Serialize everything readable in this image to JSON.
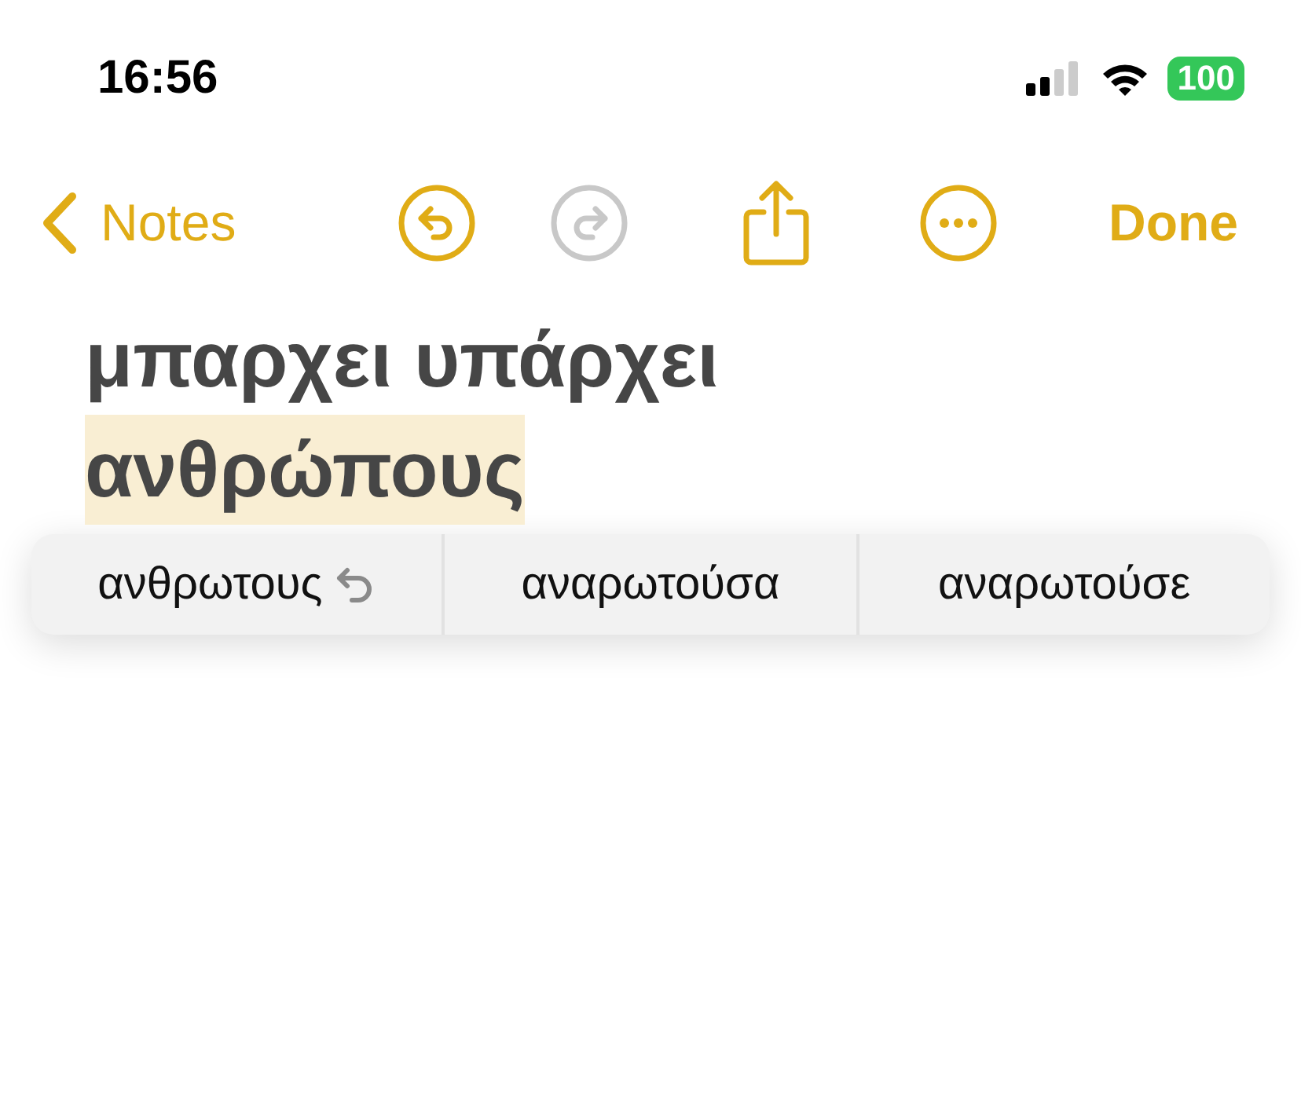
{
  "status_bar": {
    "time": "16:56",
    "battery": "100"
  },
  "nav": {
    "back_label": "Notes",
    "undo": {
      "disabled": false
    },
    "redo": {
      "disabled": true
    },
    "done_label": "Done"
  },
  "note": {
    "lines": [
      {
        "text": "μπαρχει υπάρχει",
        "highlighted": false
      },
      {
        "text": "ανθρώπους",
        "highlighted": true
      }
    ]
  },
  "suggestions": [
    {
      "text": "ανθρωτους",
      "kind": "revert"
    },
    {
      "text": "αναρωτούσα",
      "kind": "plain"
    },
    {
      "text": "αναρωτούσε",
      "kind": "plain"
    }
  ]
}
